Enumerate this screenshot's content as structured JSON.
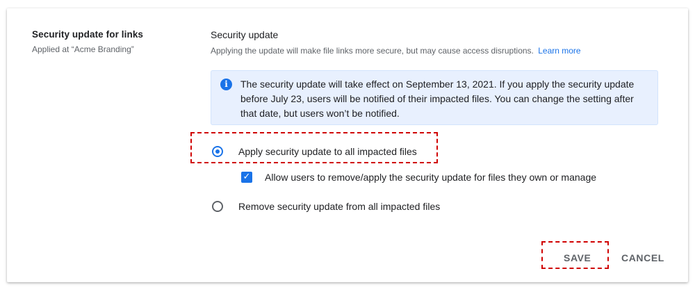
{
  "section": {
    "title": "Security update for links",
    "subtitle": "Applied at “Acme Branding”"
  },
  "setting": {
    "title": "Security update",
    "description": "Applying the update will make file links more secure, but may cause access disruptions.",
    "learn_more": "Learn more"
  },
  "info": {
    "icon": "info-icon",
    "text": "The security update will take effect on September 13, 2021. If you apply the security update before July 23, users will be notified of their impacted files. You can change the setting after that date, but users won’t be notified."
  },
  "options": {
    "apply_label": "Apply security update to all impacted files",
    "apply_selected": true,
    "allow_users_label": "Allow users to remove/apply the security update for files they own or manage",
    "allow_users_checked": true,
    "remove_label": "Remove security update from all impacted files",
    "remove_selected": false
  },
  "actions": {
    "save_label": "SAVE",
    "cancel_label": "CANCEL"
  },
  "colors": {
    "accent": "#1a73e8",
    "info_bg": "#e8f0fe",
    "highlight": "#d00000"
  }
}
